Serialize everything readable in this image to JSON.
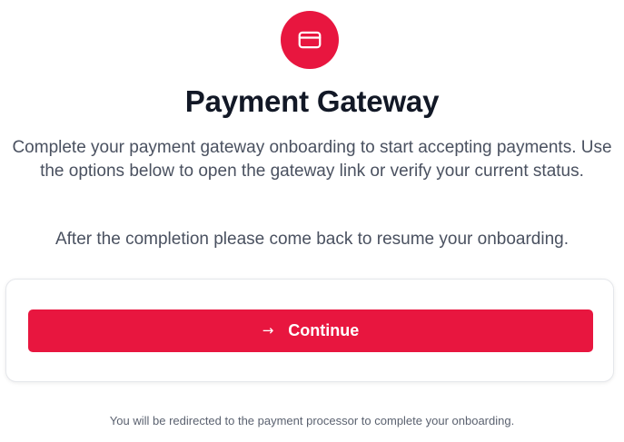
{
  "header": {
    "icon": "credit-card-icon",
    "title": "Payment Gateway"
  },
  "main": {
    "description": "Complete your payment gateway onboarding to start accepting payments. Use the options below to open the gateway link or verify your current status.",
    "instruction": "After the completion please come back to resume your onboarding."
  },
  "card": {
    "button_icon": "arrow-right-icon",
    "button_icon_glyph": "→",
    "button_label": "Continue"
  },
  "footer": {
    "note": "You will be redirected to the payment processor to complete your onboarding."
  },
  "colors": {
    "accent": "#e8163f",
    "title": "#121826",
    "body_text": "#4a5160",
    "muted_text": "#5b6270"
  }
}
